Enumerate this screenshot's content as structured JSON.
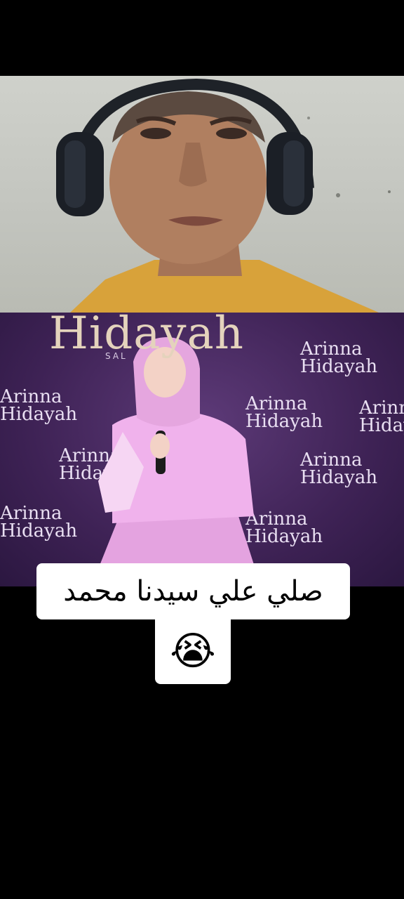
{
  "banner": {
    "headline": "Hidayah",
    "subtitle": "SAL"
  },
  "logos": [
    {
      "line1": "Arinna",
      "line2": "Hidayah"
    },
    {
      "line1": "Arinna",
      "line2": "Hidayah"
    },
    {
      "line1": "Arinna",
      "line2": "Hidayah"
    },
    {
      "line1": "Arinna",
      "line2": "Hidayah"
    },
    {
      "line1": "Arinna",
      "line2": "Hidayah"
    },
    {
      "line1": "Arinna",
      "line2": "Hidayah"
    },
    {
      "line1": "Arinna",
      "line2": "Hidayah"
    },
    {
      "line1": "Arinna",
      "line2": "Hidayah"
    }
  ],
  "caption": {
    "text": "صلي علي سيدنا محمد",
    "emoji": "😭"
  },
  "colors": {
    "background": "#000000",
    "caption_bg": "#ffffff",
    "stage_purple": "#4a2a63",
    "shirt_orange": "#d8a23a",
    "dress_pink": "#e9a6e6"
  }
}
